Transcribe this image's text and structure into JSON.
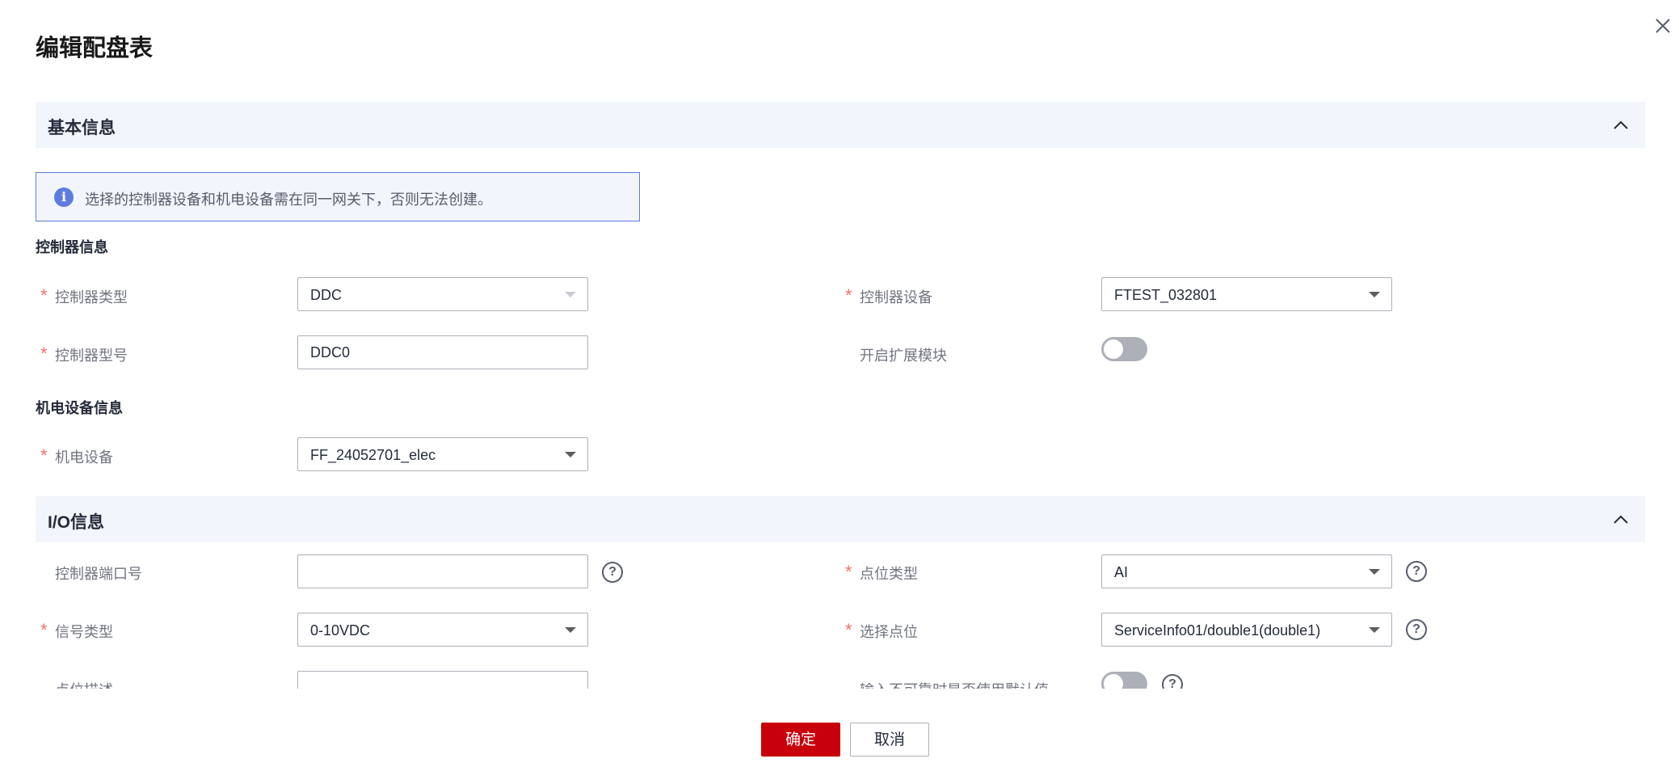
{
  "dialog": {
    "title": "编辑配盘表",
    "close_icon": "close-icon"
  },
  "basic_section": {
    "title": "基本信息",
    "collapse_icon": "chevron-up-icon",
    "alert": "选择的控制器设备和机电设备需在同一网关下，否则无法创建。"
  },
  "controller_info": {
    "title": "控制器信息",
    "controller_type": {
      "label": "控制器类型",
      "value": "DDC"
    },
    "controller_device": {
      "label": "控制器设备",
      "value": "FTEST_032801"
    },
    "controller_model": {
      "label": "控制器型号",
      "value": "DDC0"
    },
    "expansion_module": {
      "label": "开启扩展模块",
      "enabled": false
    }
  },
  "equipment_info": {
    "title": "机电设备信息",
    "equipment": {
      "label": "机电设备",
      "value": "FF_24052701_elec"
    }
  },
  "io_section": {
    "title": "I/O信息",
    "collapse_icon": "chevron-up-icon",
    "port": {
      "label": "控制器端口号",
      "value": ""
    },
    "point_type": {
      "label": "点位类型",
      "value": "AI"
    },
    "signal_type": {
      "label": "信号类型",
      "value": "0-10VDC"
    },
    "select_point": {
      "label": "选择点位",
      "value": "ServiceInfo01/double1(double1)"
    },
    "point_desc": {
      "label": "点位描述",
      "value": ""
    },
    "use_default": {
      "label": "输入不可靠时是否使用默认值",
      "enabled": false
    }
  },
  "footer": {
    "ok_label": "确定",
    "cancel_label": "取消"
  },
  "colors": {
    "primary": "#c7000b",
    "section_bg": "#f2f5fc",
    "info_blue": "#5e7ce0",
    "required": "#f66f6a"
  }
}
